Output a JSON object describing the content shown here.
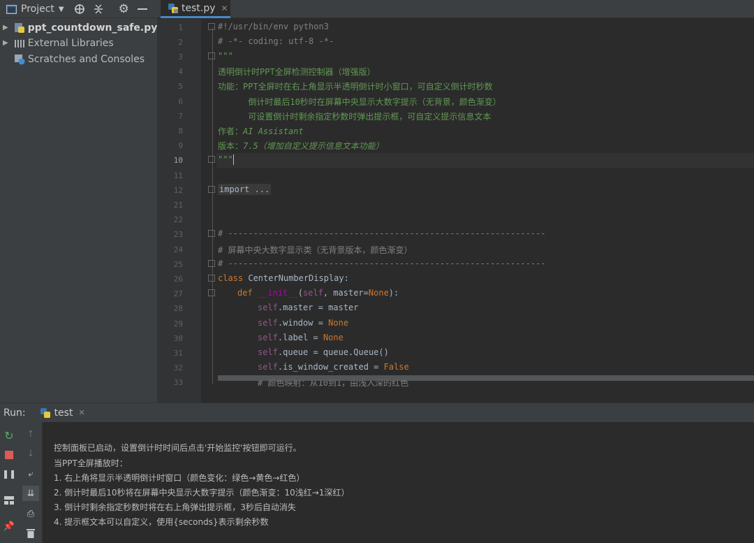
{
  "toolbar": {
    "project_label": "Project",
    "project_icon": "project-icon",
    "icons": [
      "dropdown-arrow-icon",
      "locate-icon",
      "collapse-icon",
      "gear-icon",
      "minimize-icon"
    ]
  },
  "editor_tab": {
    "label": "test.py",
    "icon": "python-file-icon"
  },
  "project_tree": [
    {
      "label": "ppt_countdown_safe.py",
      "icon": "python-file-icon",
      "bold": true
    },
    {
      "label": "External Libraries",
      "icon": "library-icon"
    },
    {
      "label": "Scratches and Consoles",
      "icon": "scratch-icon"
    }
  ],
  "line_numbers": [
    "1",
    "2",
    "3",
    "4",
    "5",
    "6",
    "7",
    "8",
    "9",
    "10",
    "11",
    "12",
    "21",
    "22",
    "23",
    "24",
    "25",
    "26",
    "27",
    "28",
    "29",
    "30",
    "31",
    "32",
    "33"
  ],
  "code": {
    "l1": "#!/usr/bin/env python3",
    "l2": "# -*- coding: utf-8 -*-",
    "l3": "\"\"\"",
    "l4": "透明倒计时PPT全屏检测控制器（增强版）",
    "l5": "功能：PPT全屏时在右上角显示半透明倒计时小窗口，可自定义倒计时秒数",
    "l6": "      倒计时最后10秒时在屏幕中央显示大数字提示（无背景，颜色渐变）",
    "l7": "      可设置倒计时剩余指定秒数时弹出提示框，可自定义提示信息文本",
    "l8_a": "作者：",
    "l8_b": "AI Assistant",
    "l9_a": "版本：",
    "l9_b": "7.5（增加自定义提示信息文本功能）",
    "l10": "\"\"\"",
    "l12": "import ...",
    "l23": "# ---------------------------------------------------------------",
    "l24": "# 屏幕中央大数字显示类（无背景版本，颜色渐变）",
    "l25": "# ---------------------------------------------------------------",
    "l26_kw": "class",
    "l26_name": " CenterNumberDisplay:",
    "l27_kw": "def",
    "l27_name": "__init__",
    "l27_rest_a": "(",
    "l27_self": "self",
    "l27_rest_b": ", master=",
    "l27_none": "None",
    "l27_rest_c": "):",
    "l28_attr": ".master = master",
    "l29_attr": ".window = ",
    "l30_attr": ".label = ",
    "l31_attr": ".queue = queue.Queue()",
    "l32_attr": ".is_window_created = ",
    "self_kw": "self",
    "none_kw": "None",
    "false_kw": "False",
    "l33": "# 颜色映射：从10到1，由浅入深的红色"
  },
  "run_panel": {
    "label": "Run:",
    "tab_label": "test",
    "tab_icon": "python-icon",
    "close_icon": "close-icon",
    "console_lines": [
      "控制面板已启动，设置倒计时时间后点击'开始监控'按钮即可运行。",
      "当PPT全屏播放时：",
      "1. 右上角将显示半透明倒计时窗口（颜色变化：绿色→黄色→红色）",
      "2. 倒计时最后10秒将在屏幕中央显示大数字提示（颜色渐变：10浅红→1深红）",
      "3. 倒计时剩余指定秒数时将在右上角弹出提示框，3秒后自动消失",
      "4. 提示框文本可以自定义，使用{seconds}表示剩余秒数"
    ]
  },
  "colors": {
    "accent": "#4a88c7",
    "rerun": "#59a869",
    "stop": "#db5c5c"
  }
}
